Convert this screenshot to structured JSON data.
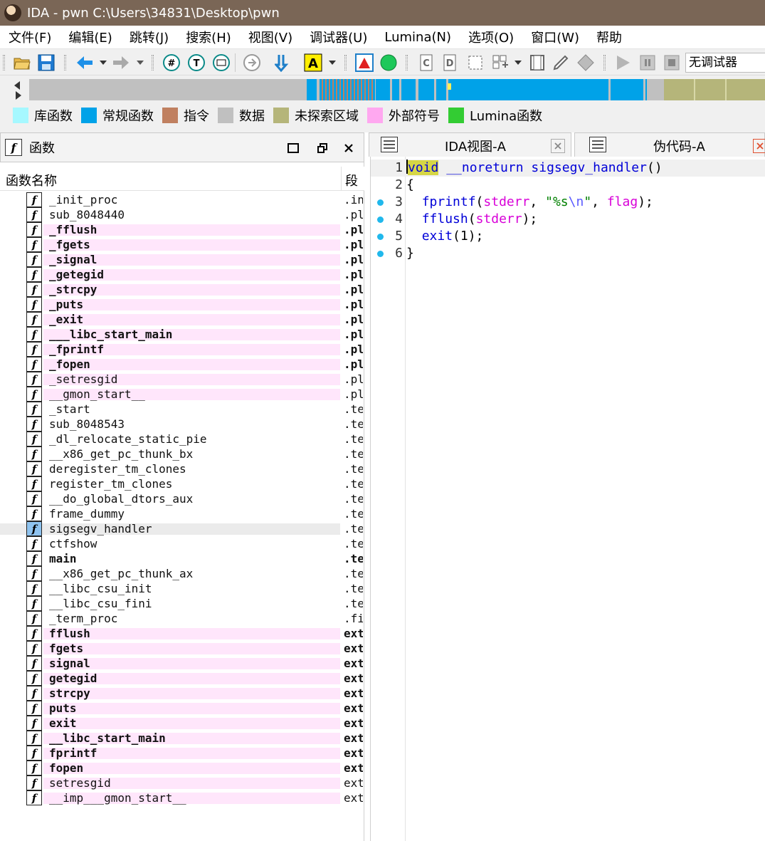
{
  "titlebar": {
    "title": "IDA - pwn C:\\Users\\34831\\Desktop\\pwn"
  },
  "menu": [
    "文件(F)",
    "编辑(E)",
    "跳转(J)",
    "搜索(H)",
    "视图(V)",
    "调试器(U)",
    "Lumina(N)",
    "选项(O)",
    "窗口(W)",
    "帮助"
  ],
  "toolbar": {
    "debugger_select": "无调试器"
  },
  "colors": {
    "titlebar": "#7a6656",
    "library_function": "#a6f8ff",
    "regular_function": "#00a2e8",
    "instruction": "#c08060",
    "data": "#c0c0c0",
    "unexplored": "#b5b57a",
    "external_symbol": "#ffa8f0",
    "lumina_function": "#33cc33",
    "external_row_bg": "#ffe6fb"
  },
  "legend": [
    {
      "label": "库函数",
      "color": "#a6f8ff"
    },
    {
      "label": "常规函数",
      "color": "#00a2e8"
    },
    {
      "label": "指令",
      "color": "#c08060"
    },
    {
      "label": "数据",
      "color": "#c0c0c0"
    },
    {
      "label": "未探索区域",
      "color": "#b5b57a"
    },
    {
      "label": "外部符号",
      "color": "#ffa8f0"
    },
    {
      "label": "Lumina函数",
      "color": "#33cc33"
    }
  ],
  "functions_pane": {
    "title": "函数",
    "col_name": "函数名称",
    "col_segment": "段",
    "rows": [
      {
        "name": "_init_proc",
        "segment": ".init",
        "kind": "normal"
      },
      {
        "name": "sub_8048440",
        "segment": ".plt",
        "kind": "normal"
      },
      {
        "name": "_fflush",
        "segment": ".plt",
        "kind": "extbold"
      },
      {
        "name": "_fgets",
        "segment": ".plt",
        "kind": "extbold"
      },
      {
        "name": "_signal",
        "segment": ".plt",
        "kind": "extbold"
      },
      {
        "name": "_getegid",
        "segment": ".plt",
        "kind": "extbold"
      },
      {
        "name": "_strcpy",
        "segment": ".plt",
        "kind": "extbold"
      },
      {
        "name": "_puts",
        "segment": ".plt",
        "kind": "extbold"
      },
      {
        "name": "_exit",
        "segment": ".plt",
        "kind": "extbold"
      },
      {
        "name": "___libc_start_main",
        "segment": ".plt",
        "kind": "extbold"
      },
      {
        "name": "_fprintf",
        "segment": ".plt",
        "kind": "extbold"
      },
      {
        "name": "_fopen",
        "segment": ".plt",
        "kind": "extbold"
      },
      {
        "name": "_setresgid",
        "segment": ".plt",
        "kind": "ext"
      },
      {
        "name": "__gmon_start__",
        "segment": ".plt",
        "kind": "ext"
      },
      {
        "name": "_start",
        "segment": ".text",
        "kind": "normal"
      },
      {
        "name": "sub_8048543",
        "segment": ".text",
        "kind": "normal"
      },
      {
        "name": "_dl_relocate_static_pie",
        "segment": ".text",
        "kind": "normal"
      },
      {
        "name": "__x86_get_pc_thunk_bx",
        "segment": ".text",
        "kind": "normal"
      },
      {
        "name": "deregister_tm_clones",
        "segment": ".text",
        "kind": "normal"
      },
      {
        "name": "register_tm_clones",
        "segment": ".text",
        "kind": "normal"
      },
      {
        "name": "__do_global_dtors_aux",
        "segment": ".text",
        "kind": "normal"
      },
      {
        "name": "frame_dummy",
        "segment": ".text",
        "kind": "normal"
      },
      {
        "name": "sigsegv_handler",
        "segment": ".text",
        "kind": "selected"
      },
      {
        "name": "ctfshow",
        "segment": ".text",
        "kind": "normal"
      },
      {
        "name": "main",
        "segment": ".text",
        "kind": "bold"
      },
      {
        "name": "__x86_get_pc_thunk_ax",
        "segment": ".text",
        "kind": "normal"
      },
      {
        "name": "__libc_csu_init",
        "segment": ".text",
        "kind": "normal"
      },
      {
        "name": "__libc_csu_fini",
        "segment": ".text",
        "kind": "normal"
      },
      {
        "name": "_term_proc",
        "segment": ".fini",
        "kind": "normal"
      },
      {
        "name": "fflush",
        "segment": "extern",
        "kind": "extbold"
      },
      {
        "name": "fgets",
        "segment": "extern",
        "kind": "extbold"
      },
      {
        "name": "signal",
        "segment": "extern",
        "kind": "extbold"
      },
      {
        "name": "getegid",
        "segment": "extern",
        "kind": "extbold"
      },
      {
        "name": "strcpy",
        "segment": "extern",
        "kind": "extbold"
      },
      {
        "name": "puts",
        "segment": "extern",
        "kind": "extbold"
      },
      {
        "name": "exit",
        "segment": "extern",
        "kind": "extbold"
      },
      {
        "name": "__libc_start_main",
        "segment": "extern",
        "kind": "extbold"
      },
      {
        "name": "fprintf",
        "segment": "extern",
        "kind": "extbold"
      },
      {
        "name": "fopen",
        "segment": "extern",
        "kind": "extbold"
      },
      {
        "name": "setresgid",
        "segment": "extern",
        "kind": "ext"
      },
      {
        "name": "__imp___gmon_start__",
        "segment": "extern",
        "kind": "ext"
      }
    ]
  },
  "tabs": [
    {
      "label": "IDA视图-A",
      "active": false
    },
    {
      "label": "伪代码-A",
      "active": true
    }
  ],
  "pseudocode": {
    "lines": [
      {
        "no": "1",
        "has_dot": false,
        "tokens": [
          [
            "kw-hl",
            "void"
          ],
          [
            "plain",
            " "
          ],
          [
            "kw",
            "__noreturn"
          ],
          [
            "plain",
            " "
          ],
          [
            "kw",
            "sigsegv_handler"
          ],
          [
            "plain",
            "()"
          ]
        ]
      },
      {
        "no": "2",
        "has_dot": false,
        "tokens": [
          [
            "plain",
            "{"
          ]
        ]
      },
      {
        "no": "3",
        "has_dot": true,
        "tokens": [
          [
            "plain",
            "  "
          ],
          [
            "fn",
            "fprintf"
          ],
          [
            "plain",
            "("
          ],
          [
            "var",
            "stderr"
          ],
          [
            "plain",
            ", "
          ],
          [
            "str",
            "\"%s"
          ],
          [
            "esc",
            "\\n"
          ],
          [
            "str",
            "\""
          ],
          [
            "plain",
            ", "
          ],
          [
            "var",
            "flag"
          ],
          [
            "plain",
            ");"
          ]
        ]
      },
      {
        "no": "4",
        "has_dot": true,
        "tokens": [
          [
            "plain",
            "  "
          ],
          [
            "fn",
            "fflush"
          ],
          [
            "plain",
            "("
          ],
          [
            "var",
            "stderr"
          ],
          [
            "plain",
            ");"
          ]
        ]
      },
      {
        "no": "5",
        "has_dot": true,
        "tokens": [
          [
            "plain",
            "  "
          ],
          [
            "fn",
            "exit"
          ],
          [
            "plain",
            "(1);"
          ]
        ]
      },
      {
        "no": "6",
        "has_dot": true,
        "tokens": [
          [
            "plain",
            "}"
          ]
        ]
      }
    ]
  }
}
